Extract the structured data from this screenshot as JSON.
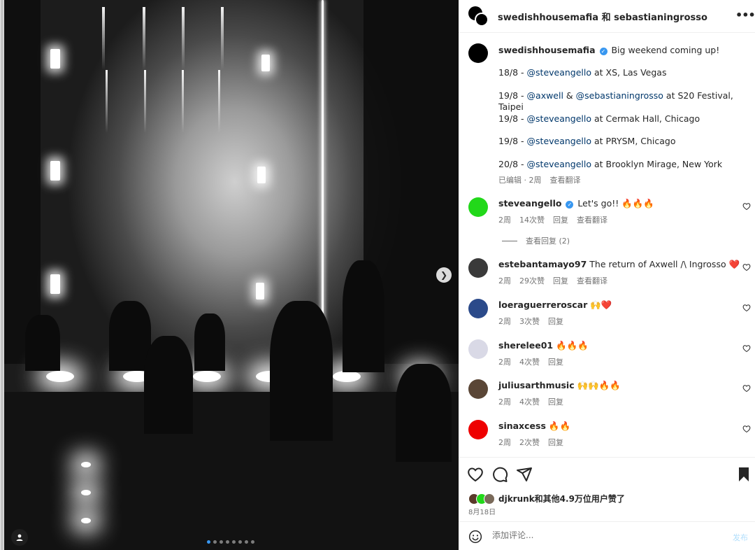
{
  "post": {
    "header_title": "swedishhousemafia 和 sebastianingrosso",
    "more_icon": "more-horizontal-icon",
    "carousel": {
      "current_slide": 1,
      "total_slides": 8
    }
  },
  "caption": {
    "username": "swedishhousemafia",
    "text": "Big weekend coming up!",
    "lines": [
      {
        "date": "18/8 - ",
        "mention": "@steveangello",
        "rest": " at XS, Las Vegas"
      },
      {
        "date": "19/8 - ",
        "mention": "@axwell",
        "mid": " & ",
        "mention2": "@sebastianingrosso",
        "rest": " at S20 Festival, Taipei"
      },
      {
        "date": "19/8 - ",
        "mention": "@steveangello",
        "rest": " at Cermak Hall, Chicago"
      },
      {
        "date": "19/8 - ",
        "mention": "@steveangello",
        "rest": " at PRYSM, Chicago"
      },
      {
        "date": "20/8 - ",
        "mention": "@steveangello",
        "rest": " at Brooklyn Mirage, New York"
      }
    ],
    "edited": "已编辑 · 2周",
    "translate": "查看翻译"
  },
  "comments": [
    {
      "username": "steveangello",
      "verified": true,
      "text": "Let's go!! 🔥🔥🔥",
      "time": "2周",
      "likes": "14次赞",
      "reply": "回复",
      "translate": "查看翻译",
      "avatar_color": "#22d81a"
    },
    {
      "username": "estebantamayo97",
      "verified": false,
      "text": "The return of Axwell /\\ Ingrosso ❤️",
      "time": "2周",
      "likes": "29次赞",
      "reply": "回复",
      "translate": "查看翻译",
      "avatar_color": "#3a3a3a"
    },
    {
      "username": "loeraguerreroscar",
      "verified": false,
      "text": "🙌❤️",
      "time": "2周",
      "likes": "3次赞",
      "reply": "回复",
      "avatar_color": "#2b4a8a"
    },
    {
      "username": "sherelee01",
      "verified": false,
      "text": "🔥🔥🔥",
      "time": "2周",
      "likes": "4次赞",
      "reply": "回复",
      "avatar_color": "#d9d9e6"
    },
    {
      "username": "juliusarthmusic",
      "verified": false,
      "text": "🙌🙌🔥🔥",
      "time": "2周",
      "likes": "4次赞",
      "reply": "回复",
      "avatar_color": "#5a4636"
    },
    {
      "username": "sinaxcess",
      "verified": false,
      "text": "🔥🔥",
      "time": "2周",
      "likes": "2次赞",
      "reply": "回复",
      "avatar_color": "#ee0000"
    }
  ],
  "view_replies": "查看回复 (2)",
  "actions": {
    "likes_text": "djkrunk和其他4.9万位用户赞了",
    "date": "8月18日"
  },
  "composer": {
    "placeholder": "添加评论...",
    "post_label": "发布"
  },
  "colors": {
    "link": "#00376b",
    "verified": "#3897f0",
    "muted": "#737373"
  }
}
